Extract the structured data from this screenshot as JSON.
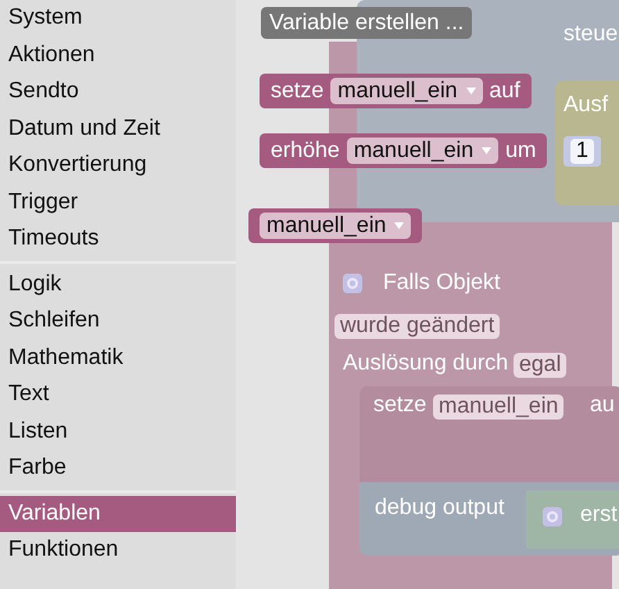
{
  "toolbox": {
    "groups": [
      [
        {
          "label": "System",
          "selected": false
        },
        {
          "label": "Aktionen",
          "selected": false
        },
        {
          "label": "Sendto",
          "selected": false
        },
        {
          "label": "Datum und Zeit",
          "selected": false
        },
        {
          "label": "Konvertierung",
          "selected": false
        },
        {
          "label": "Trigger",
          "selected": false
        },
        {
          "label": "Timeouts",
          "selected": false
        }
      ],
      [
        {
          "label": "Logik",
          "selected": false
        },
        {
          "label": "Schleifen",
          "selected": false
        },
        {
          "label": "Mathematik",
          "selected": false
        },
        {
          "label": "Text",
          "selected": false
        },
        {
          "label": "Listen",
          "selected": false
        },
        {
          "label": "Farbe",
          "selected": false
        }
      ],
      [
        {
          "label": "Variablen",
          "selected": true
        },
        {
          "label": "Funktionen",
          "selected": false
        }
      ]
    ]
  },
  "flyout": {
    "create_button": "Variable erstellen ...",
    "blocks": [
      {
        "kind": "set",
        "before": "setze",
        "variable": "manuell_ein",
        "after": "auf"
      },
      {
        "kind": "change",
        "before": "erhöhe",
        "variable": "manuell_ein",
        "after": "um",
        "value": "1"
      },
      {
        "kind": "get",
        "variable": "manuell_ein"
      }
    ]
  },
  "workspace": {
    "top_block_text": "steue",
    "side_block_text": "Ausf",
    "event_block": {
      "title": "Falls Objekt",
      "trigger": "wurde geändert",
      "source_label": "Auslösung durch",
      "source": "egal",
      "set_word": "setze",
      "set_variable": "manuell_ein",
      "set_tail": "au",
      "debug_label": "debug output",
      "debug_value": "erst"
    }
  }
}
